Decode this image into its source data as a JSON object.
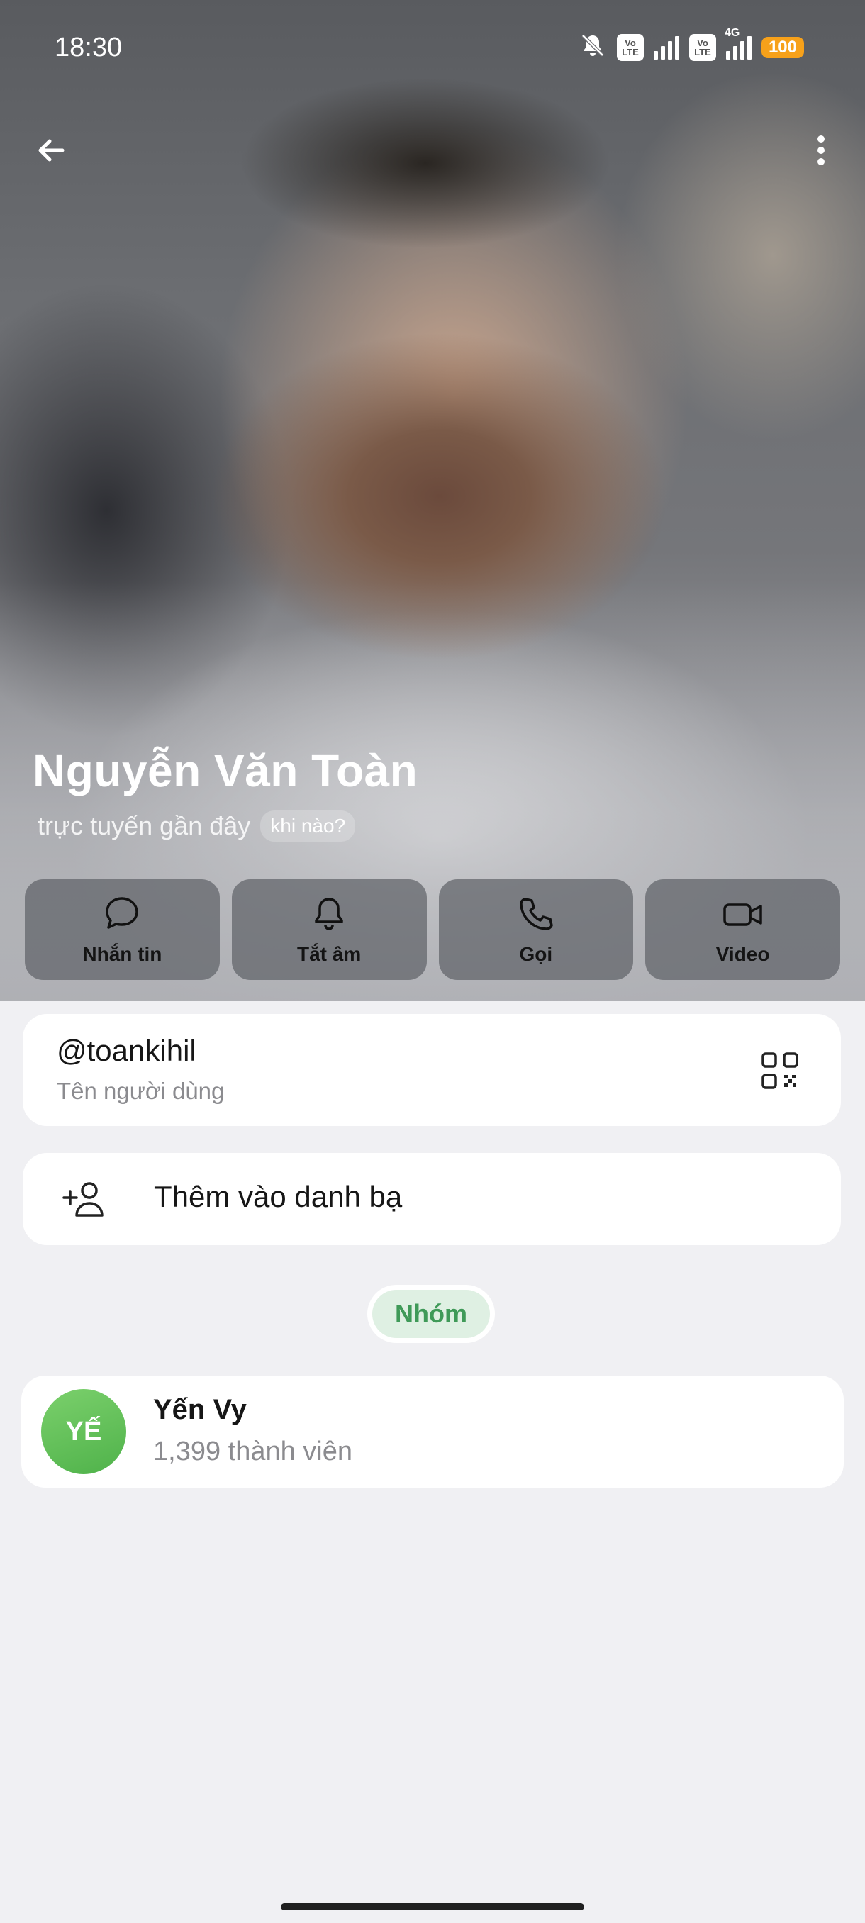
{
  "status_bar": {
    "time": "18:30",
    "volte_label_1": "Vo",
    "volte_label_2": "LTE",
    "network_label": "4G",
    "battery": "100"
  },
  "header": {
    "back_icon": "arrow-left-icon",
    "more_icon": "more-vertical-icon"
  },
  "profile": {
    "name": "Nguyễn Văn Toàn",
    "last_seen": "trực tuyến gần đây",
    "when_chip": "khi nào?"
  },
  "actions": [
    {
      "label": "Nhắn tin",
      "icon": "message-icon"
    },
    {
      "label": "Tắt âm",
      "icon": "bell-icon"
    },
    {
      "label": "Gọi",
      "icon": "phone-icon"
    },
    {
      "label": "Video",
      "icon": "video-icon"
    }
  ],
  "username": {
    "value": "@toankihil",
    "label": "Tên người dùng",
    "icon": "qr-code-icon"
  },
  "add_contact": {
    "label": "Thêm vào danh bạ",
    "icon": "add-person-icon"
  },
  "groups_section": {
    "label": "Nhóm"
  },
  "groups": [
    {
      "initials": "YẾ",
      "name": "Yến Vy",
      "members": "1,399 thành viên"
    }
  ],
  "colors": {
    "accent_green": "#3f9a58",
    "chip_bg": "#dff0e3",
    "battery": "#f7a11a",
    "avatar_green": "#5cbf52"
  }
}
